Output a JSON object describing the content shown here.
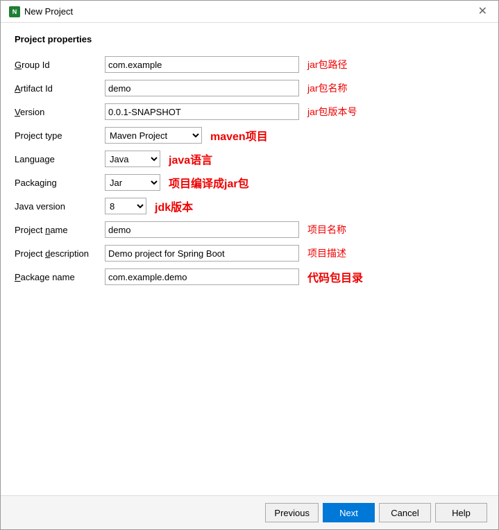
{
  "window": {
    "title": "New Project",
    "icon": "N"
  },
  "section": {
    "title": "Project properties"
  },
  "form": {
    "group_id_label": "Group Id",
    "group_id_value": "com.example",
    "group_id_annotation": "jar包路径",
    "artifact_id_label": "Artifact Id",
    "artifact_id_value": "demo",
    "artifact_id_annotation": "jar包名称",
    "version_label": "Version",
    "version_value": "0.0.1-SNAPSHOT",
    "version_annotation": "jar包版本号",
    "project_type_label": "Project type",
    "project_type_value": "Maven Project",
    "project_type_annotation": "maven项目",
    "language_label": "Language",
    "language_value": "Java",
    "language_annotation": "java语言",
    "packaging_label": "Packaging",
    "packaging_value": "Jar",
    "packaging_annotation": "项目编译成jar包",
    "java_version_label": "Java version",
    "java_version_value": "8",
    "java_version_annotation": "jdk版本",
    "project_name_label": "Project name",
    "project_name_value": "demo",
    "project_name_annotation": "项目名称",
    "project_desc_label": "Project description",
    "project_desc_value": "Demo project for Spring Boot",
    "project_desc_annotation": "项目描述",
    "package_name_label": "Package name",
    "package_name_value": "com.example.demo",
    "package_name_annotation": "代码包目录"
  },
  "footer": {
    "previous_label": "Previous",
    "next_label": "Next",
    "cancel_label": "Cancel",
    "help_label": "Help"
  }
}
